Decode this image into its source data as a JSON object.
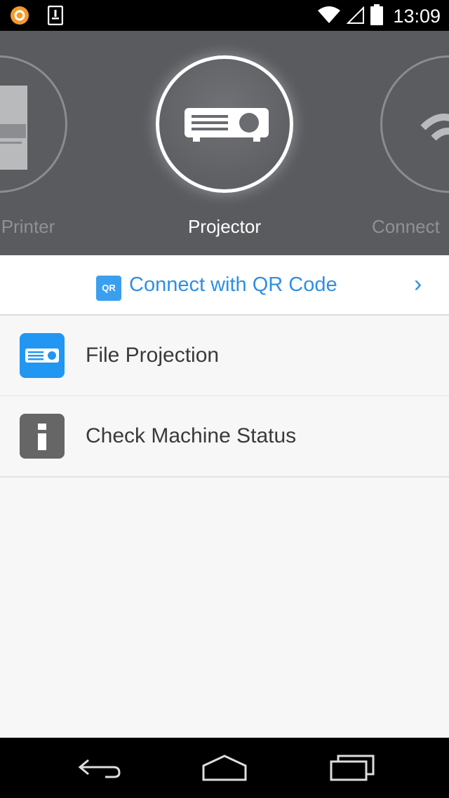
{
  "status_bar": {
    "time": "13:09",
    "icons": [
      "app-notification-icon",
      "download-icon",
      "wifi-icon",
      "signal-icon",
      "battery-icon"
    ]
  },
  "carousel": {
    "items": [
      {
        "label": "Printer",
        "icon": "printer-icon",
        "selected": false
      },
      {
        "label": "Projector",
        "icon": "projector-icon",
        "selected": true
      },
      {
        "label": "Connect",
        "icon": "wifi-icon",
        "selected": false
      }
    ]
  },
  "qr": {
    "badge": "QR",
    "label": "Connect with QR Code",
    "chevron": "›"
  },
  "menu": {
    "items": [
      {
        "label": "File Projection",
        "icon": "projector-icon",
        "color": "#2196f3"
      },
      {
        "label": "Check Machine Status",
        "icon": "info-icon",
        "color": "#666666"
      }
    ]
  },
  "nav_bar": {
    "icons": [
      "back-icon",
      "home-icon",
      "recent-apps-icon"
    ]
  }
}
